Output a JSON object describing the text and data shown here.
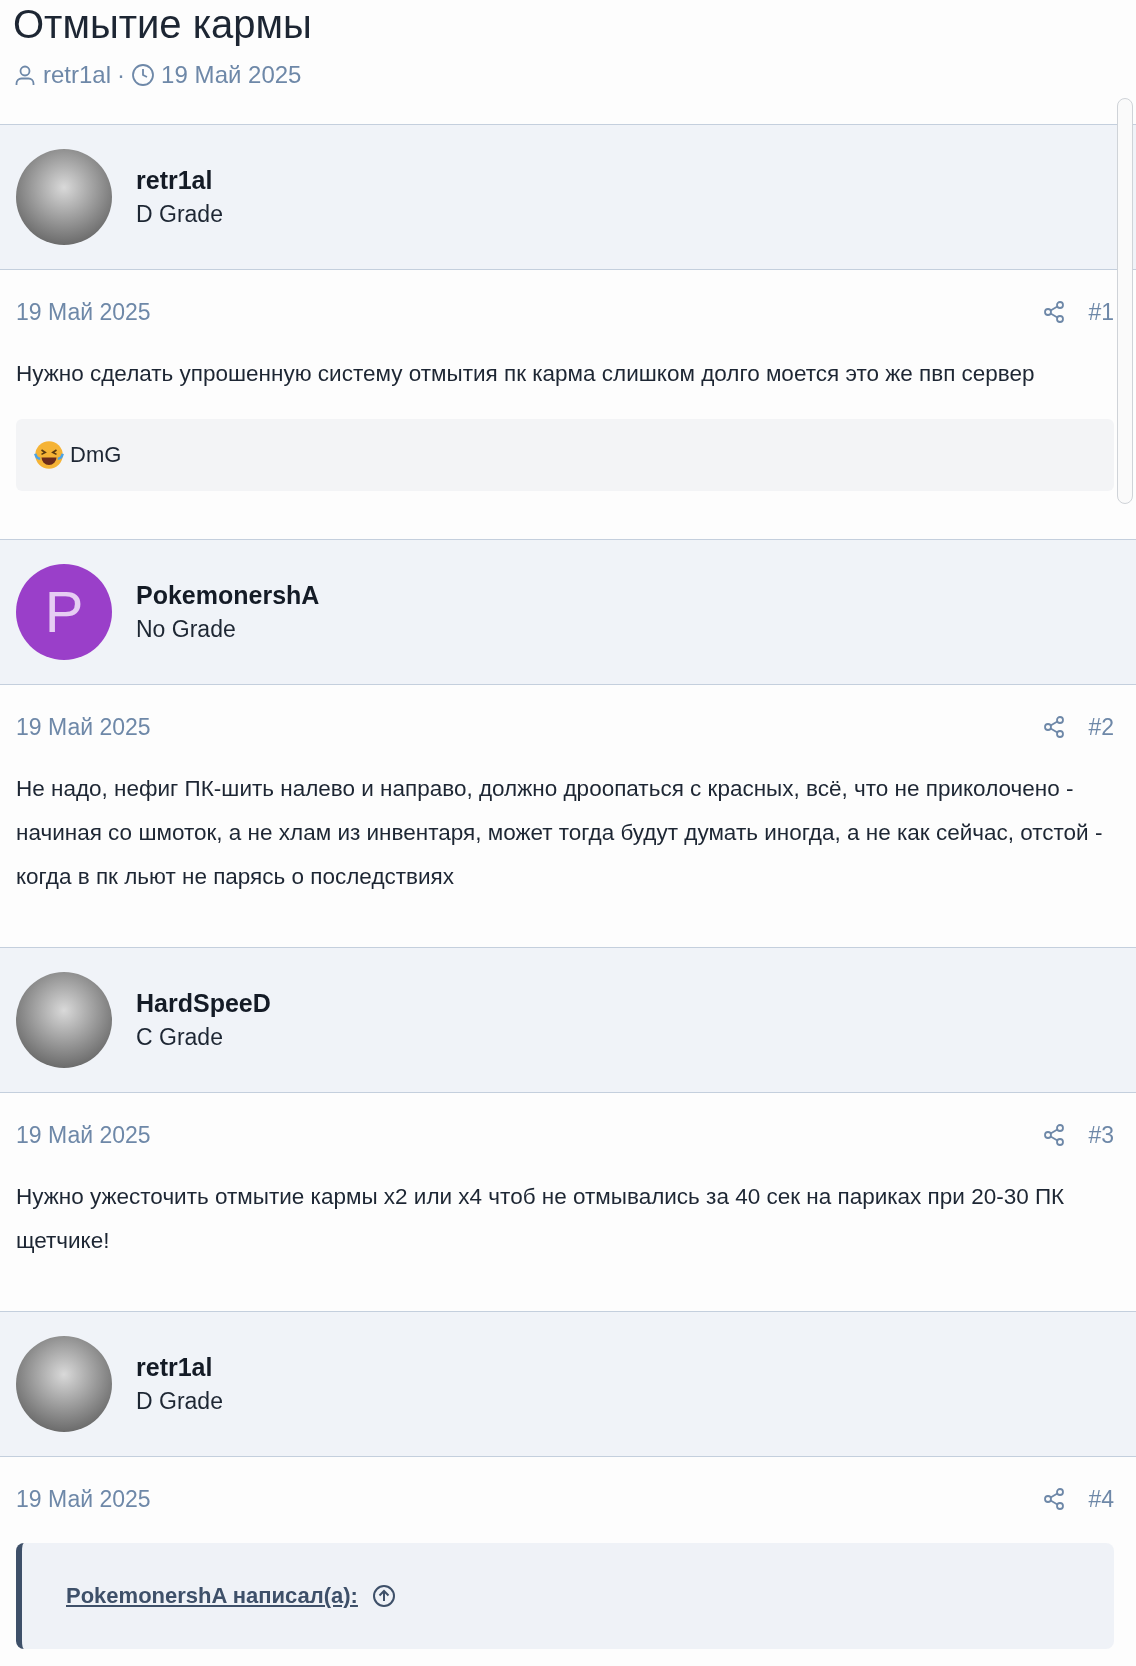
{
  "thread": {
    "title": "Отмытие кармы",
    "author": "retr1al",
    "separator": "·",
    "date": "19 Май 2025"
  },
  "posts": [
    {
      "author": "retr1al",
      "grade": "D Grade",
      "avatar": {
        "kind": "photo"
      },
      "date": "19 Май 2025",
      "number": "#1",
      "body": "Нужно сделать упрошенную систему отмытия пк карма слишком долго моется это же пвп сервер",
      "reactions": [
        {
          "user": "DmG"
        }
      ]
    },
    {
      "author": "PokemonershA",
      "grade": "No Grade",
      "avatar": {
        "kind": "letter",
        "letter": "P",
        "color": "#9a3fc9"
      },
      "date": "19 Май 2025",
      "number": "#2",
      "body": "Не надо, нефиг ПК-шить налево и направо, должно дроопаться с красных, всё, что не приколочено - начиная со шмоток, а не хлам из инвентаря, может тогда будут думать иногда, а не как сейчас, отстой - когда в пк льют не парясь о последствиях"
    },
    {
      "author": "HardSpeeD",
      "grade": "C Grade",
      "avatar": {
        "kind": "photo"
      },
      "date": "19 Май 2025",
      "number": "#3",
      "body": "Нужно ужесточить отмытие кармы x2 или x4 чтоб не отмывались за 40 сек на париках при 20-30 ПК щетчике!"
    },
    {
      "author": "retr1al",
      "grade": "D Grade",
      "avatar": {
        "kind": "photo"
      },
      "date": "19 Май 2025",
      "number": "#4",
      "quote": {
        "attribution": "PokemonershA написал(а):"
      }
    }
  ]
}
